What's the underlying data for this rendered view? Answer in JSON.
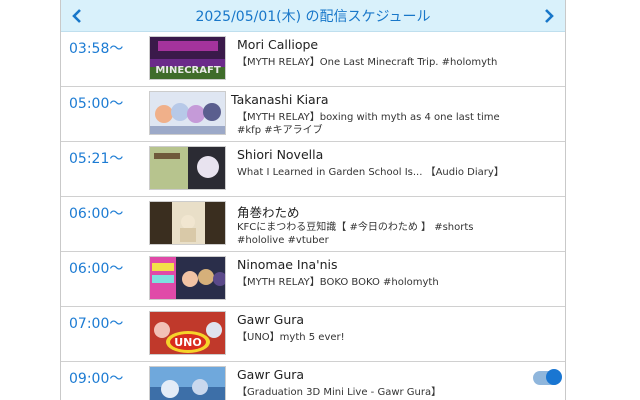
{
  "header": {
    "title": "2025/05/01(木) の配信スケジュール",
    "prev_icon": "chevron-left-icon",
    "next_icon": "chevron-right-icon",
    "accent_color": "#1877c9",
    "background_color": "#d9f1fb"
  },
  "schedule": [
    {
      "time": "03:58〜",
      "name": "Mori Calliope",
      "title": "【MYTH RELAY】One Last Minecraft Trip. #holomyth",
      "thumbnail_text": "MINECRAFT"
    },
    {
      "time": "05:00〜",
      "name": "Takanashi Kiara",
      "title": "【MYTH RELAY】boxing with myth as 4 one last time #kfp #キアライブ",
      "thumbnail_text": ""
    },
    {
      "time": "05:21〜",
      "name": "Shiori Novella",
      "title": "What I Learned in Garden School Is... 【Audio Diary】",
      "thumbnail_text": ""
    },
    {
      "time": "06:00〜",
      "name": "角巻わため",
      "title": "KFCにまつわる豆知識【 #今日のわため 】 #shorts #hololive #vtuber",
      "thumbnail_text": ""
    },
    {
      "time": "06:00〜",
      "name": "Ninomae Ina'nis",
      "title": "【MYTH RELAY】BOKO BOKO #holomyth",
      "thumbnail_text": ""
    },
    {
      "time": "07:00〜",
      "name": "Gawr Gura",
      "title": "【UNO】myth 5 ever!",
      "thumbnail_text": "UNO"
    },
    {
      "time": "09:00〜",
      "name": "Gawr Gura",
      "title": "【Graduation 3D Mini Live - Gawr Gura】",
      "thumbnail_text": "",
      "toggle_on": true
    }
  ]
}
